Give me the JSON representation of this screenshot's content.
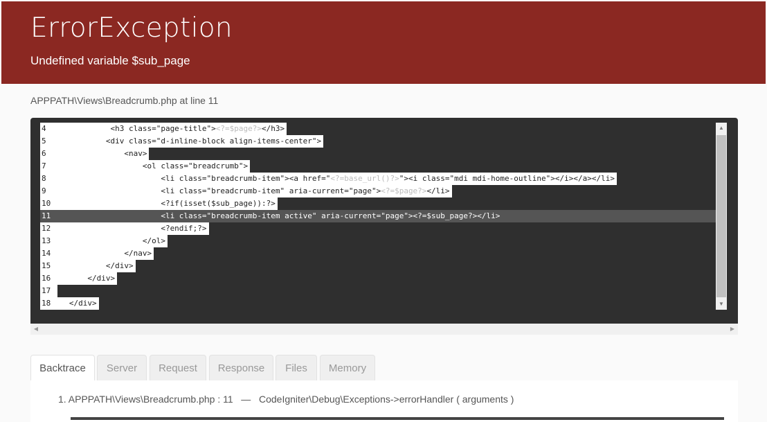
{
  "header": {
    "title": "ErrorException",
    "message": "Undefined variable $sub_page"
  },
  "location": "APPPATH\\Views\\Breadcrumb.php at line 11",
  "source": {
    "highlight_line": 11,
    "lines": [
      {
        "num": "4",
        "indent": "            ",
        "code": "<h3 class=\"page-title\">",
        "php": "<?=$page?>",
        "rest": "</h3>"
      },
      {
        "num": "5",
        "indent": "           ",
        "code": "<div class=\"d-inline-block align-items-center\">",
        "php": "",
        "rest": ""
      },
      {
        "num": "6",
        "indent": "               ",
        "code": "<nav>",
        "php": "",
        "rest": ""
      },
      {
        "num": "7",
        "indent": "                   ",
        "code": "<ol class=\"breadcrumb\">",
        "php": "",
        "rest": ""
      },
      {
        "num": "8",
        "indent": "                       ",
        "code": "<li class=\"breadcrumb-item\"><a href=\"",
        "php": "<?=base_url()?>",
        "rest": "\"><i class=\"mdi mdi-home-outline\"></i></a></li>"
      },
      {
        "num": "9",
        "indent": "                       ",
        "code": "<li class=\"breadcrumb-item\" aria-current=\"page\">",
        "php": "<?=$page?>",
        "rest": "</li>"
      },
      {
        "num": "10",
        "indent": "                       ",
        "code": "<?if(isset($sub_page)):?>",
        "php": "",
        "rest": ""
      },
      {
        "num": "11",
        "indent": "                       ",
        "code": "<li class=\"breadcrumb-item active\" aria-current=\"page\"><?=$sub_page?></li>",
        "php": "",
        "rest": ""
      },
      {
        "num": "12",
        "indent": "                       ",
        "code": "<?endif;?>",
        "php": "",
        "rest": ""
      },
      {
        "num": "13",
        "indent": "                   ",
        "code": "</ol>",
        "php": "",
        "rest": ""
      },
      {
        "num": "14",
        "indent": "               ",
        "code": "</nav>",
        "php": "",
        "rest": ""
      },
      {
        "num": "15",
        "indent": "           ",
        "code": "</div>",
        "php": "",
        "rest": ""
      },
      {
        "num": "16",
        "indent": "       ",
        "code": "</div>",
        "php": "",
        "rest": ""
      },
      {
        "num": "17",
        "indent": "",
        "code": "",
        "php": "",
        "rest": ""
      },
      {
        "num": "18",
        "indent": "   ",
        "code": "</div>",
        "php": "",
        "rest": ""
      }
    ]
  },
  "tabs": [
    "Backtrace",
    "Server",
    "Request",
    "Response",
    "Files",
    "Memory"
  ],
  "active_tab": "Backtrace",
  "backtrace": {
    "item_1": "1. APPPATH\\Views\\Breadcrumb.php : 11   —   CodeIgniter\\Debug\\Exceptions->errorHandler ( arguments )"
  },
  "colors": {
    "header_bg": "#8b2822",
    "code_bg": "#2f2f2f",
    "highlight_bg": "#555555"
  }
}
